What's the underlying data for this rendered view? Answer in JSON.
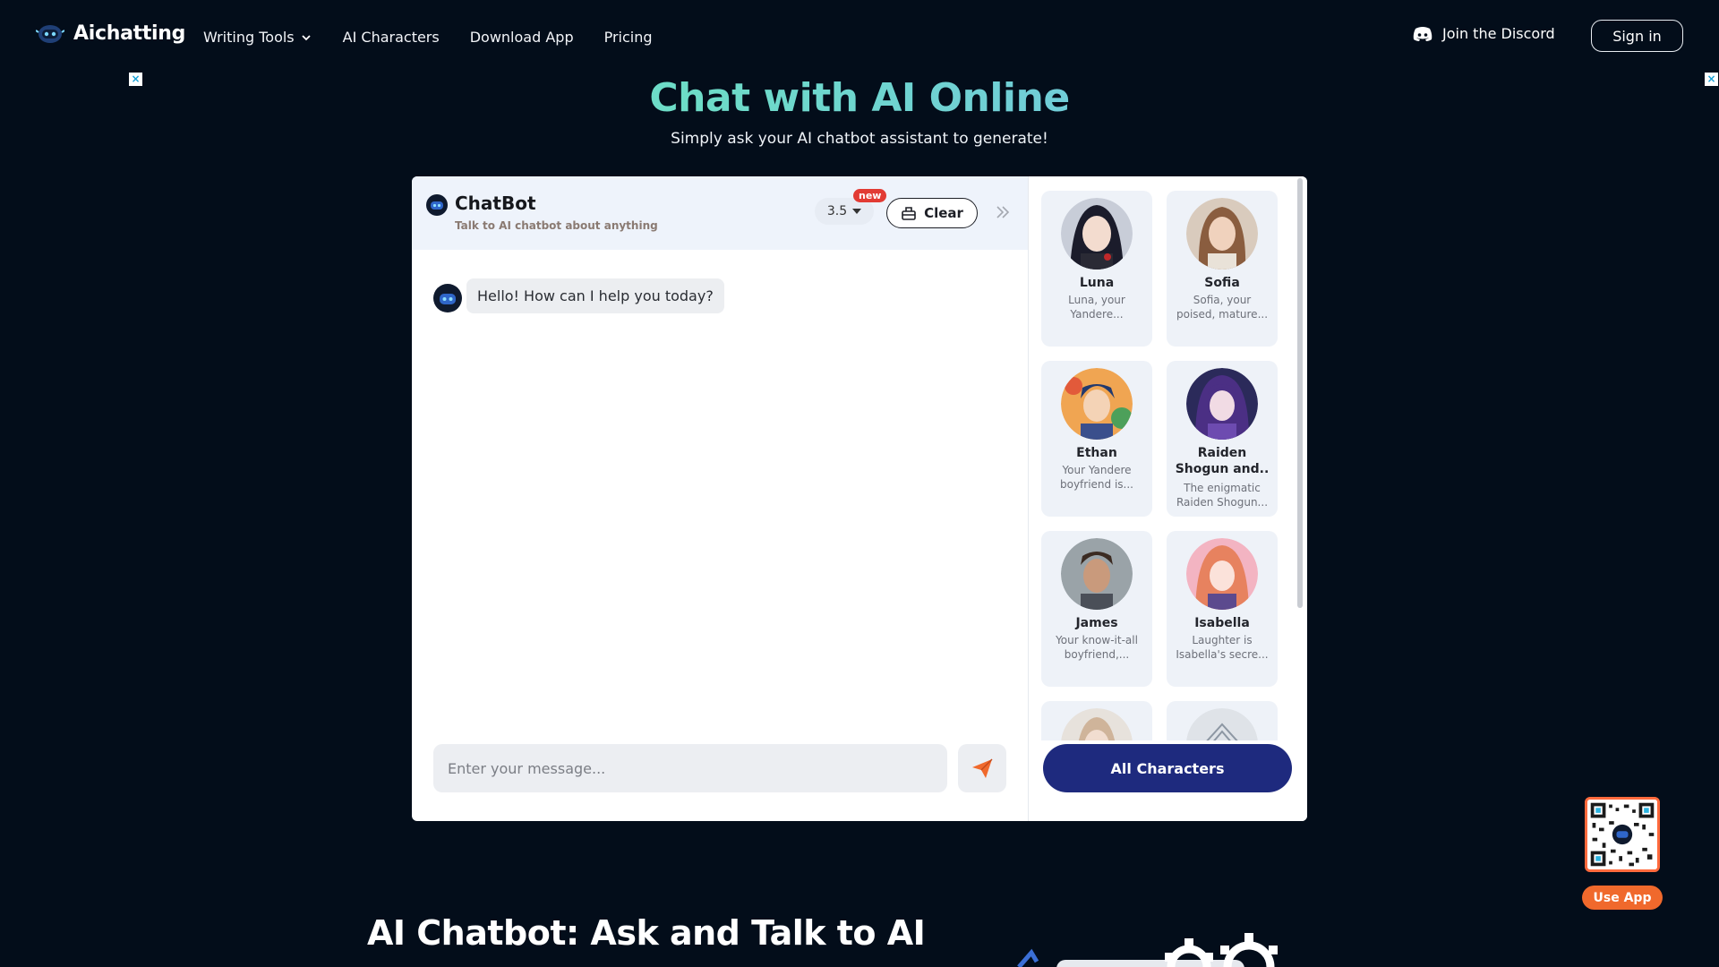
{
  "header": {
    "logo_text": "Aichatting",
    "nav": [
      {
        "label": "Writing Tools",
        "has_dropdown": true
      },
      {
        "label": "AI Characters"
      },
      {
        "label": "Download App"
      },
      {
        "label": "Pricing"
      }
    ],
    "discord_label": "Join the Discord",
    "signin_label": "Sign in"
  },
  "hero": {
    "title": "Chat with AI Online",
    "subtitle": "Simply ask your AI chatbot assistant to generate!"
  },
  "chat": {
    "title": "ChatBot",
    "subtitle": "Talk to AI chatbot about anything",
    "model": "3.5",
    "new_badge": "new",
    "clear_label": "Clear",
    "messages": [
      {
        "role": "bot",
        "text": "Hello! How can I help you today?"
      }
    ],
    "input_placeholder": "Enter your message..."
  },
  "characters": {
    "items": [
      {
        "name": "Luna",
        "desc": "Luna, your Yandere..."
      },
      {
        "name": "Sofia",
        "desc": "Sofia, your poised, mature..."
      },
      {
        "name": "Ethan",
        "desc": "Your Yandere boyfriend is..."
      },
      {
        "name": "Raiden Shogun and..",
        "desc": "The enigmatic Raiden Shogun..."
      },
      {
        "name": "James",
        "desc": "Your know-it-all boyfriend,..."
      },
      {
        "name": "Isabella",
        "desc": "Laughter is Isabella's secre..."
      }
    ],
    "all_label": "All Characters"
  },
  "section": {
    "title": "AI Chatbot: Ask and Talk to AI"
  },
  "app_promo": {
    "use_app_label": "Use App"
  },
  "colors": {
    "background": "#030d1a",
    "accent_navy": "#1e2a7e",
    "accent_orange": "#f0692c",
    "badge_red": "#e23b34"
  }
}
